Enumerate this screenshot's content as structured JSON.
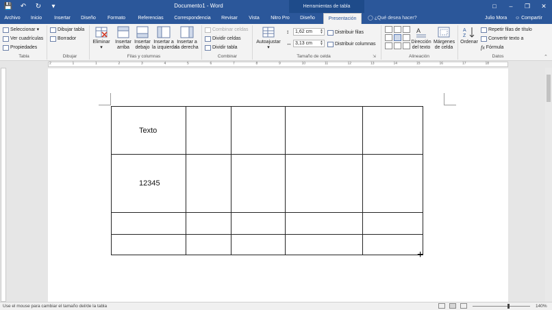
{
  "window": {
    "title": "Documento1 - Word",
    "context_header": "Herramientas de tabla",
    "qat_icons": [
      "save-icon",
      "undo-icon",
      "redo-icon",
      "customize-icon"
    ],
    "controls": [
      "ribbon-display-icon",
      "minimize-icon",
      "maximize-icon",
      "close-icon"
    ]
  },
  "tabs": [
    "Archivo",
    "Inicio",
    "Insertar",
    "Diseño",
    "Formato",
    "Referencias",
    "Correspondencia",
    "Revisar",
    "Vista",
    "Nitro Pro",
    "Diseño",
    "Presentación"
  ],
  "active_tab": "Presentación",
  "tell_me": "¿Qué desea hacer?",
  "user": "Julio Mora",
  "share": "Compartir",
  "ribbon": {
    "tabla": {
      "label": "Tabla",
      "items": [
        "Seleccionar",
        "Ver cuadrículas",
        "Propiedades"
      ]
    },
    "dibujar": {
      "label": "Dibujar",
      "items": [
        "Dibujar tabla",
        "Borrador"
      ]
    },
    "eliminar": "Eliminar",
    "filas": {
      "label": "Filas y columnas",
      "insertar_arriba": [
        "Insertar",
        "arriba"
      ],
      "insertar_debajo": [
        "Insertar",
        "debajo"
      ],
      "insertar_izq": [
        "Insertar a",
        "la izquierda"
      ],
      "insertar_der": [
        "Insertar a",
        "la derecha"
      ]
    },
    "combinar": {
      "label": "Combinar",
      "items": [
        "Combinar celdas",
        "Dividir celdas",
        "Dividir tabla"
      ]
    },
    "autoajustar": "Autoajustar",
    "tamano": {
      "label": "Tamaño de celda",
      "height": "1,62 cm",
      "width": "3,13 cm",
      "distribuir_filas": "Distribuir filas",
      "distribuir_columnas": "Distribuir columnas"
    },
    "alineacion": {
      "label": "Alineación",
      "direccion": [
        "Dirección",
        "del texto"
      ],
      "margenes": [
        "Márgenes",
        "de celda"
      ]
    },
    "datos": {
      "label": "Datos",
      "ordenar": "Ordenar",
      "items": [
        "Repetir filas de título",
        "Convertir texto a",
        "Fórmula"
      ]
    }
  },
  "ruler_ticks": [
    "2",
    "1",
    "1",
    "2",
    "3",
    "4",
    "5",
    "6",
    "7",
    "8",
    "9",
    "10",
    "11",
    "12",
    "13",
    "14",
    "15",
    "16",
    "17",
    "18"
  ],
  "table": {
    "rows": [
      [
        "Texto",
        "",
        "",
        "",
        ""
      ],
      [
        "12345",
        "",
        "",
        "",
        ""
      ],
      [
        "",
        "",
        "",
        "",
        ""
      ],
      [
        "",
        "",
        "",
        "",
        ""
      ]
    ]
  },
  "status": {
    "message": "Use el mouse para cambiar el tamaño del/de la tabla",
    "zoom": "140%",
    "zoom_level": 0.62
  }
}
